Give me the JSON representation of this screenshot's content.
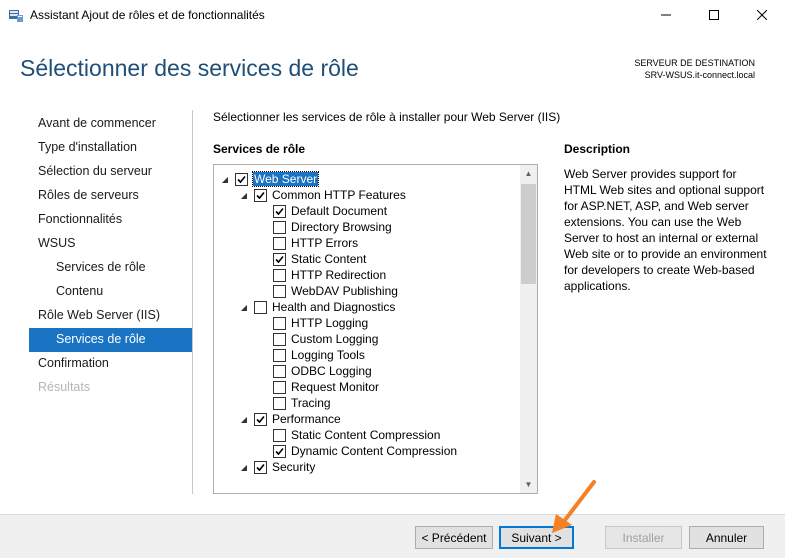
{
  "window": {
    "title": "Assistant Ajout de rôles et de fonctionnalités"
  },
  "header": {
    "title": "Sélectionner des services de rôle",
    "destination_label": "SERVEUR DE DESTINATION",
    "destination_server": "SRV-WSUS.it-connect.local"
  },
  "nav": {
    "items": [
      {
        "label": "Avant de commencer"
      },
      {
        "label": "Type d'installation"
      },
      {
        "label": "Sélection du serveur"
      },
      {
        "label": "Rôles de serveurs"
      },
      {
        "label": "Fonctionnalités"
      },
      {
        "label": "WSUS"
      },
      {
        "label": "Services de rôle"
      },
      {
        "label": "Contenu"
      },
      {
        "label": "Rôle Web Server (IIS)"
      },
      {
        "label": "Services de rôle"
      },
      {
        "label": "Confirmation"
      },
      {
        "label": "Résultats"
      }
    ]
  },
  "main": {
    "instruction": "Sélectionner les services de rôle à installer pour Web Server (IIS)",
    "services_title": "Services de rôle",
    "tree": [
      {
        "label": "Web Server",
        "checked": true
      },
      {
        "label": "Common HTTP Features",
        "checked": true
      },
      {
        "label": "Default Document",
        "checked": true
      },
      {
        "label": "Directory Browsing",
        "checked": false
      },
      {
        "label": "HTTP Errors",
        "checked": false
      },
      {
        "label": "Static Content",
        "checked": true
      },
      {
        "label": "HTTP Redirection",
        "checked": false
      },
      {
        "label": "WebDAV Publishing",
        "checked": false
      },
      {
        "label": "Health and Diagnostics",
        "checked": false
      },
      {
        "label": "HTTP Logging",
        "checked": false
      },
      {
        "label": "Custom Logging",
        "checked": false
      },
      {
        "label": "Logging Tools",
        "checked": false
      },
      {
        "label": "ODBC Logging",
        "checked": false
      },
      {
        "label": "Request Monitor",
        "checked": false
      },
      {
        "label": "Tracing",
        "checked": false
      },
      {
        "label": "Performance",
        "checked": true
      },
      {
        "label": "Static Content Compression",
        "checked": false
      },
      {
        "label": "Dynamic Content Compression",
        "checked": true
      },
      {
        "label": "Security",
        "checked": true
      }
    ],
    "description_title": "Description",
    "description_text": "Web Server provides support for HTML Web sites and optional support for ASP.NET, ASP, and Web server extensions. You can use the Web Server to host an internal or external Web site or to provide an environment for developers to create Web-based applications."
  },
  "buttons": {
    "previous": "< Précédent",
    "next": "Suivant >",
    "install": "Installer",
    "cancel": "Annuler"
  },
  "colors": {
    "accent": "#1a73c3",
    "title": "#1f4e79",
    "annotation_arrow": "#f58025"
  }
}
